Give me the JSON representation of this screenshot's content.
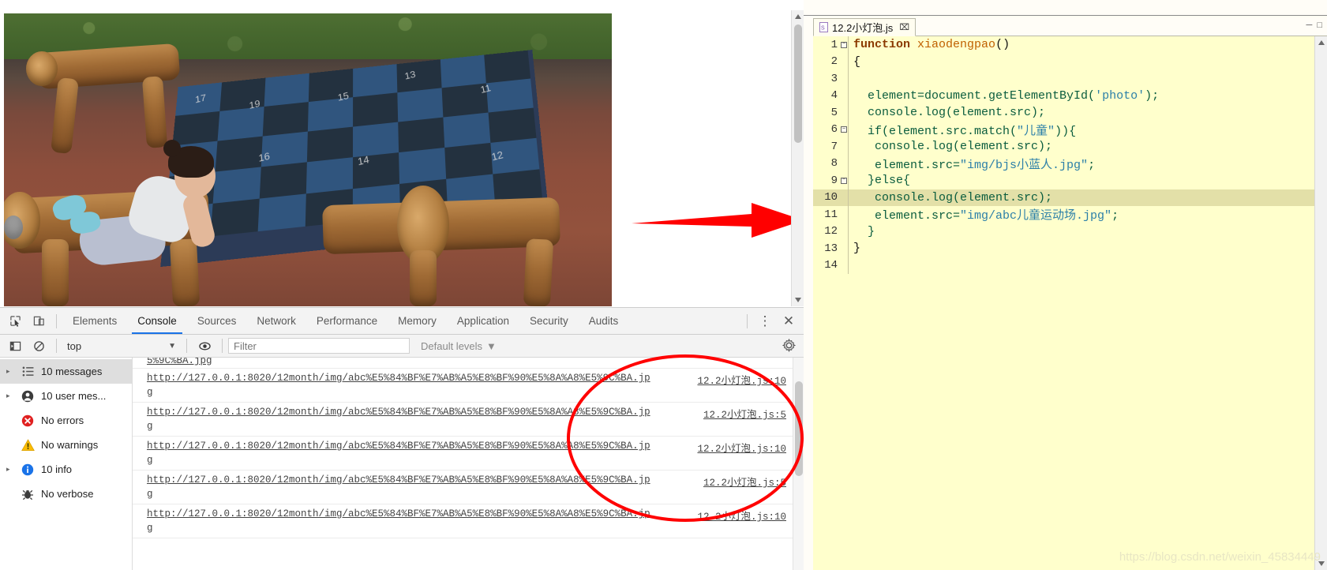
{
  "browser": {
    "photo_alt": "child-playing-on-wooden-playground-equipment",
    "board_numbers": [
      "17",
      "19",
      "13",
      "15",
      "11",
      "16",
      "14",
      "12"
    ]
  },
  "devtools": {
    "toolbar": {
      "inspect_icon": "inspect-element-icon",
      "device_icon": "device-toolbar-icon",
      "tabs": [
        {
          "label": "Elements",
          "active": false
        },
        {
          "label": "Console",
          "active": true
        },
        {
          "label": "Sources",
          "active": false
        },
        {
          "label": "Network",
          "active": false
        },
        {
          "label": "Performance",
          "active": false
        },
        {
          "label": "Memory",
          "active": false
        },
        {
          "label": "Application",
          "active": false
        },
        {
          "label": "Security",
          "active": false
        },
        {
          "label": "Audits",
          "active": false
        }
      ],
      "more_label": "⋮",
      "close_label": "✕"
    },
    "filterbar": {
      "sidebar_toggle_icon": "show-console-sidebar-icon",
      "clear_icon": "clear-console-icon",
      "context": "top",
      "context_caret": "▼",
      "eye_icon": "live-expression-icon",
      "filter_value": "",
      "filter_placeholder": "Filter",
      "levels_label": "Default levels",
      "levels_caret": "▼",
      "settings_icon": "gear-icon"
    },
    "sidebar": [
      {
        "label": "10 messages",
        "icon": "list-icon",
        "expandable": true,
        "selected": true
      },
      {
        "label": "10 user mes...",
        "icon": "user-icon",
        "expandable": true,
        "selected": false
      },
      {
        "label": "No errors",
        "icon": "error-icon",
        "expandable": false,
        "selected": false
      },
      {
        "label": "No warnings",
        "icon": "warning-icon",
        "expandable": false,
        "selected": false
      },
      {
        "label": "10 info",
        "icon": "info-icon",
        "expandable": true,
        "selected": false
      },
      {
        "label": "No verbose",
        "icon": "verbose-icon",
        "expandable": false,
        "selected": false
      }
    ],
    "messages": [
      {
        "url": "",
        "url_tail": "5%9C%BA.jpg",
        "source": "",
        "partial_top": true
      },
      {
        "url": "http://127.0.0.1:8020/12month/img/abc%E5%84%BF%E7%AB%A5%E8%BF%90%E5%8A%A8%E5%9C%BA.jpg",
        "source": "12.2小灯泡.js:10"
      },
      {
        "url": "http://127.0.0.1:8020/12month/img/abc%E5%84%BF%E7%AB%A5%E8%BF%90%E5%8A%A8%E5%9C%BA.jpg",
        "source": "12.2小灯泡.js:5"
      },
      {
        "url": "http://127.0.0.1:8020/12month/img/abc%E5%84%BF%E7%AB%A5%E8%BF%90%E5%8A%A8%E5%9C%BA.jpg",
        "source": "12.2小灯泡.js:10"
      },
      {
        "url": "http://127.0.0.1:8020/12month/img/abc%E5%84%BF%E7%AB%A5%E8%BF%90%E5%8A%A8%E5%9C%BA.jpg",
        "source": "12.2小灯泡.js:5"
      },
      {
        "url": "http://127.0.0.1:8020/12month/img/abc%E5%84%BF%E7%AB%A5%E8%BF%90%E5%8A%A8%E5%9C%BA.jpg",
        "source": "12.2小灯泡.js:10"
      }
    ]
  },
  "editor": {
    "tab": {
      "title": "12.2小灯泡.js",
      "file_icon": "js-file-icon",
      "close_label": "⌧"
    },
    "window_buttons": {
      "minimize": "─",
      "maximize": "□"
    },
    "lines": [
      {
        "no": "1",
        "fold": "-",
        "text": "function xiaodengpao()"
      },
      {
        "no": "2",
        "fold": "",
        "text": "{"
      },
      {
        "no": "3",
        "fold": "",
        "text": ""
      },
      {
        "no": "4",
        "fold": "",
        "text": "  element=document.getElementById('photo');"
      },
      {
        "no": "5",
        "fold": "",
        "text": "  console.log(element.src);"
      },
      {
        "no": "6",
        "fold": "-",
        "text": "  if(element.src.match(\"儿童\")){"
      },
      {
        "no": "7",
        "fold": "",
        "text": "   console.log(element.src);"
      },
      {
        "no": "8",
        "fold": "",
        "text": "   element.src=\"img/bjs小蓝人.jpg\";"
      },
      {
        "no": "9",
        "fold": "-",
        "text": "  }else{"
      },
      {
        "no": "10",
        "fold": "",
        "text": "   console.log(element.src);",
        "highlight": true
      },
      {
        "no": "11",
        "fold": "",
        "text": "   element.src=\"img/abc儿童运动场.jpg\";"
      },
      {
        "no": "12",
        "fold": "",
        "text": "  }"
      },
      {
        "no": "13",
        "fold": "",
        "text": "}"
      },
      {
        "no": "14",
        "fold": "",
        "text": ""
      }
    ]
  },
  "annotations": {
    "arrow_color": "#ff0000",
    "ellipse_color": "#ff0000",
    "watermark": "https://blog.csdn.net/weixin_45834449"
  }
}
